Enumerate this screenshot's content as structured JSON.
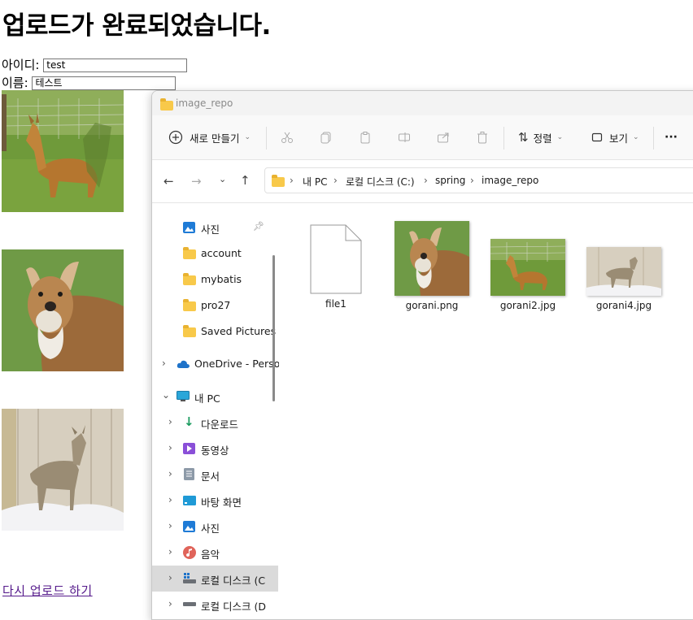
{
  "page": {
    "heading": "업로드가 완료되었습니다.",
    "id_label": "아이디:",
    "id_value": "test",
    "name_label": "이름:",
    "name_value": "테스트",
    "reupload_link": "다시 업로드 하기"
  },
  "explorer": {
    "window_title": "image_repo",
    "toolbar": {
      "new_label": "새로 만들기",
      "sort_label": "정렬",
      "view_label": "보기",
      "more_label": "···"
    },
    "breadcrumb": [
      "내 PC",
      "로컬 디스크 (C:)",
      "spring",
      "image_repo"
    ],
    "nav_items": [
      {
        "label": "사진",
        "icon": "photos-icon"
      },
      {
        "label": "account",
        "icon": "folder-icon"
      },
      {
        "label": "mybatis",
        "icon": "folder-icon"
      },
      {
        "label": "pro27",
        "icon": "folder-icon"
      },
      {
        "label": "Saved Pictures",
        "icon": "folder-icon"
      },
      {
        "label": "OneDrive - Perso",
        "icon": "cloud-icon"
      },
      {
        "label": "내 PC",
        "icon": "pc-icon"
      },
      {
        "label": "다운로드",
        "icon": "download-icon"
      },
      {
        "label": "동영상",
        "icon": "video-icon"
      },
      {
        "label": "문서",
        "icon": "document-icon"
      },
      {
        "label": "바탕 화면",
        "icon": "desktop-icon"
      },
      {
        "label": "사진",
        "icon": "photos-icon"
      },
      {
        "label": "음악",
        "icon": "music-icon"
      },
      {
        "label": "로컬 디스크 (C",
        "icon": "drive-icon"
      },
      {
        "label": "로컬 디스크 (D",
        "icon": "drive-icon"
      }
    ],
    "files": [
      {
        "name": "file1",
        "type": "blank-file"
      },
      {
        "name": "gorani.png",
        "type": "image"
      },
      {
        "name": "gorani2.jpg",
        "type": "image"
      },
      {
        "name": "gorani4.jpg",
        "type": "image"
      }
    ]
  },
  "colors": {
    "link": "#551a8b",
    "folder": "#f8c94a",
    "selection": "#dadada"
  }
}
